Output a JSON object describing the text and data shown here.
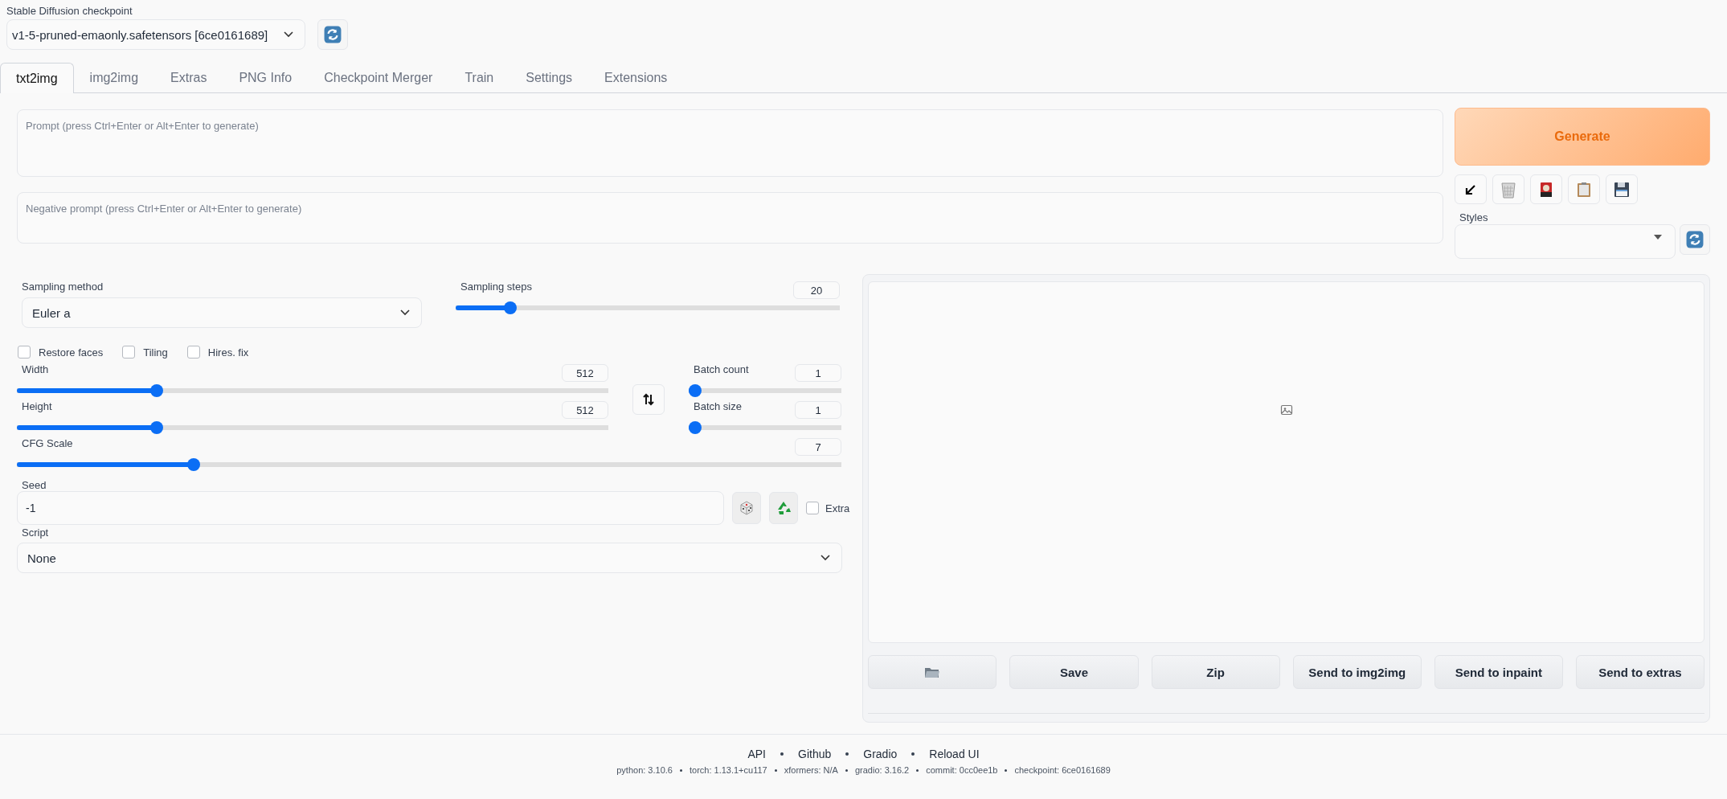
{
  "checkpoint": {
    "label": "Stable Diffusion checkpoint",
    "value": "v1-5-pruned-emaonly.safetensors [6ce0161689]"
  },
  "tabs": [
    {
      "label": "txt2img",
      "selected": true
    },
    {
      "label": "img2img",
      "selected": false
    },
    {
      "label": "Extras",
      "selected": false
    },
    {
      "label": "PNG Info",
      "selected": false
    },
    {
      "label": "Checkpoint Merger",
      "selected": false
    },
    {
      "label": "Train",
      "selected": false
    },
    {
      "label": "Settings",
      "selected": false
    },
    {
      "label": "Extensions",
      "selected": false
    }
  ],
  "prompt": {
    "placeholder": "Prompt (press Ctrl+Enter or Alt+Enter to generate)"
  },
  "negative_prompt": {
    "placeholder": "Negative prompt (press Ctrl+Enter or Alt+Enter to generate)"
  },
  "generate_button": "Generate",
  "styles": {
    "label": "Styles"
  },
  "sampling_method": {
    "label": "Sampling method",
    "value": "Euler a"
  },
  "sampling_steps": {
    "label": "Sampling steps",
    "value": "20",
    "level": 0.13
  },
  "checkboxes": [
    {
      "label": "Restore faces",
      "checked": false
    },
    {
      "label": "Tiling",
      "checked": false
    },
    {
      "label": "Hires. fix",
      "checked": false
    }
  ],
  "width": {
    "label": "Width",
    "value": "512",
    "level": 0.23
  },
  "height": {
    "label": "Height",
    "value": "512",
    "level": 0.23
  },
  "batch_count": {
    "label": "Batch count",
    "value": "1",
    "level": 0
  },
  "batch_size": {
    "label": "Batch size",
    "value": "1",
    "level": 0
  },
  "cfg_scale": {
    "label": "CFG Scale",
    "value": "7",
    "level": 0.21
  },
  "seed": {
    "label": "Seed",
    "value": "-1"
  },
  "extra": {
    "label": "Extra",
    "checked": false
  },
  "script": {
    "label": "Script",
    "value": "None"
  },
  "output_buttons": [
    {
      "kind": "folder"
    },
    {
      "kind": "text",
      "label": "Save"
    },
    {
      "kind": "text",
      "label": "Zip"
    },
    {
      "kind": "text",
      "label": "Send to img2img"
    },
    {
      "kind": "text",
      "label": "Send to inpaint"
    },
    {
      "kind": "text",
      "label": "Send to extras"
    }
  ],
  "footer": {
    "links": [
      "API",
      "Github",
      "Gradio",
      "Reload UI"
    ],
    "info": [
      "python: 3.10.6",
      "torch: 1.13.1+cu117",
      "xformers: N/A",
      "gradio: 3.16.2",
      "commit: 0cc0ee1b",
      "checkpoint: 6ce0161689"
    ]
  }
}
